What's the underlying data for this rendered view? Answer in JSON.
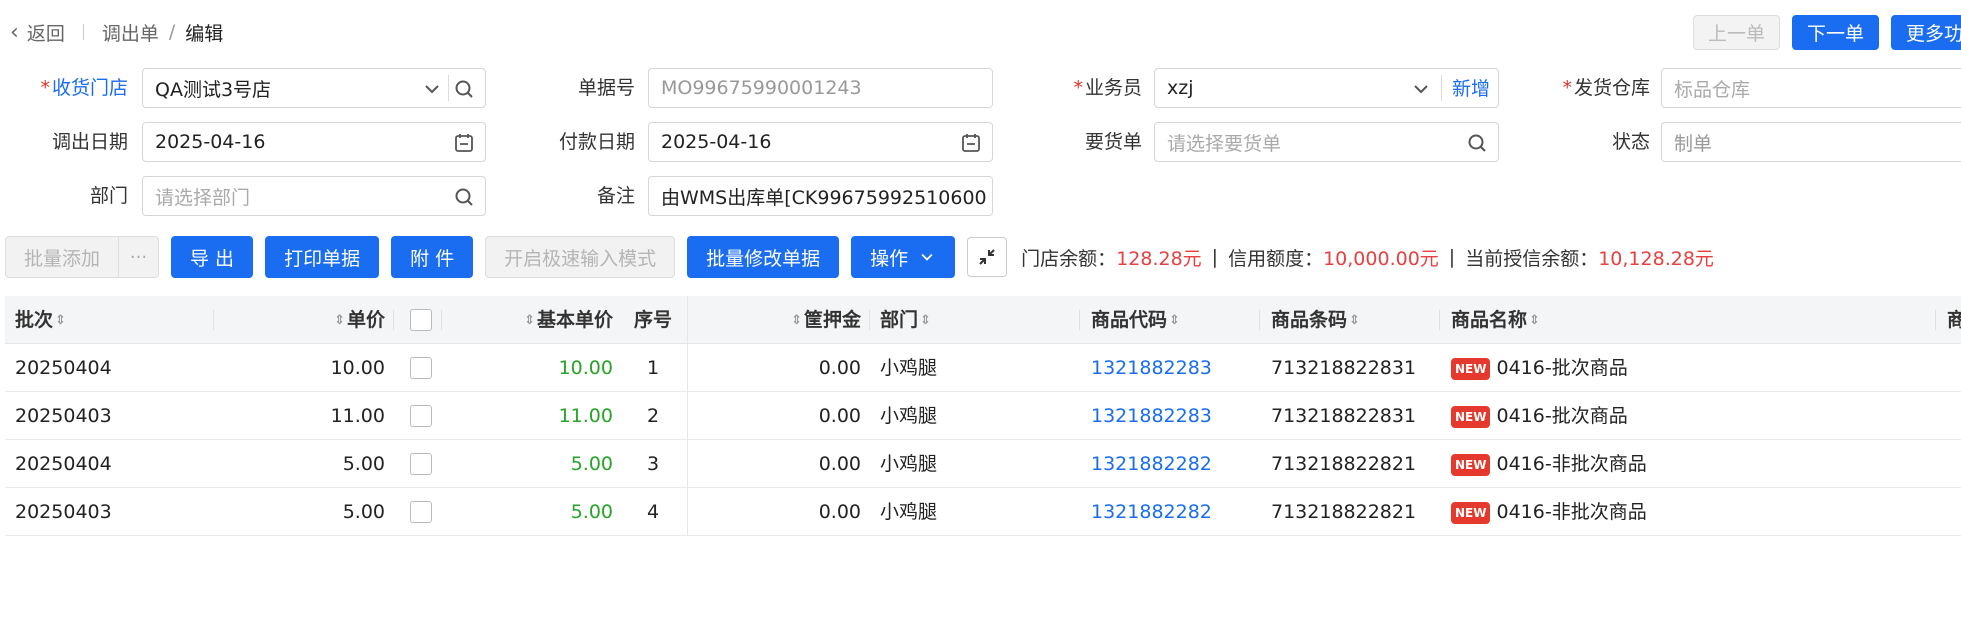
{
  "breadcrumb": {
    "back": "返回",
    "parent": "调出单",
    "current": "编辑"
  },
  "top_buttons": {
    "prev": "上一单",
    "next": "下一单",
    "more": "更多功能"
  },
  "form": {
    "store_label": "收货门店",
    "store_value": "QA测试3号店",
    "doc_no_label": "单据号",
    "doc_no_value": "MO99675990001243",
    "salesman_label": "业务员",
    "salesman_value": "xzj",
    "salesman_add": "新增",
    "warehouse_label": "发货仓库",
    "warehouse_placeholder": "标品仓库",
    "out_date_label": "调出日期",
    "out_date_value": "2025-04-16",
    "pay_date_label": "付款日期",
    "pay_date_value": "2025-04-16",
    "request_label": "要货单",
    "request_placeholder": "请选择要货单",
    "status_label": "状态",
    "status_value": "制单",
    "dept_label": "部门",
    "dept_placeholder": "请选择部门",
    "remark_label": "备注",
    "remark_value": "由WMS出库单[CK99675992510600"
  },
  "toolbar": {
    "batch_add": "批量添加",
    "more": "···",
    "export": "导 出",
    "print": "打印单据",
    "attach": "附 件",
    "fast_input": "开启极速输入模式",
    "batch_modify": "批量修改单据",
    "operate": "操作",
    "store_balance_label": "门店余额：",
    "store_balance": "128.28元",
    "credit_label": "信用额度：",
    "credit": "10,000.00元",
    "credit_remain_label": "当前授信余额：",
    "credit_remain": "10,128.28元",
    "sep": "|"
  },
  "table": {
    "headers": {
      "batch": "批次",
      "price": "单价",
      "base_price": "基本单价",
      "seq": "序号",
      "deposit": "筐押金",
      "dept": "部门",
      "code": "商品代码",
      "barcode": "商品条码",
      "name": "商品名称",
      "extra": "商"
    },
    "new_badge": "NEW",
    "rows": [
      {
        "batch": "20250404",
        "price": "10.00",
        "base_price": "10.00",
        "seq": "1",
        "deposit": "0.00",
        "dept": "小鸡腿",
        "code": "1321882283",
        "barcode": "713218822831",
        "name": "0416-批次商品"
      },
      {
        "batch": "20250403",
        "price": "11.00",
        "base_price": "11.00",
        "seq": "2",
        "deposit": "0.00",
        "dept": "小鸡腿",
        "code": "1321882283",
        "barcode": "713218822831",
        "name": "0416-批次商品"
      },
      {
        "batch": "20250404",
        "price": "5.00",
        "base_price": "5.00",
        "seq": "3",
        "deposit": "0.00",
        "dept": "小鸡腿",
        "code": "1321882282",
        "barcode": "713218822821",
        "name": "0416-非批次商品"
      },
      {
        "batch": "20250403",
        "price": "5.00",
        "base_price": "5.00",
        "seq": "4",
        "deposit": "0.00",
        "dept": "小鸡腿",
        "code": "1321882282",
        "barcode": "713218822821",
        "name": "0416-非批次商品"
      }
    ]
  },
  "colors": {
    "primary": "#1a6cf0",
    "amount_red": "#e84040",
    "price_green": "#27a327",
    "required": "#e0312b"
  }
}
